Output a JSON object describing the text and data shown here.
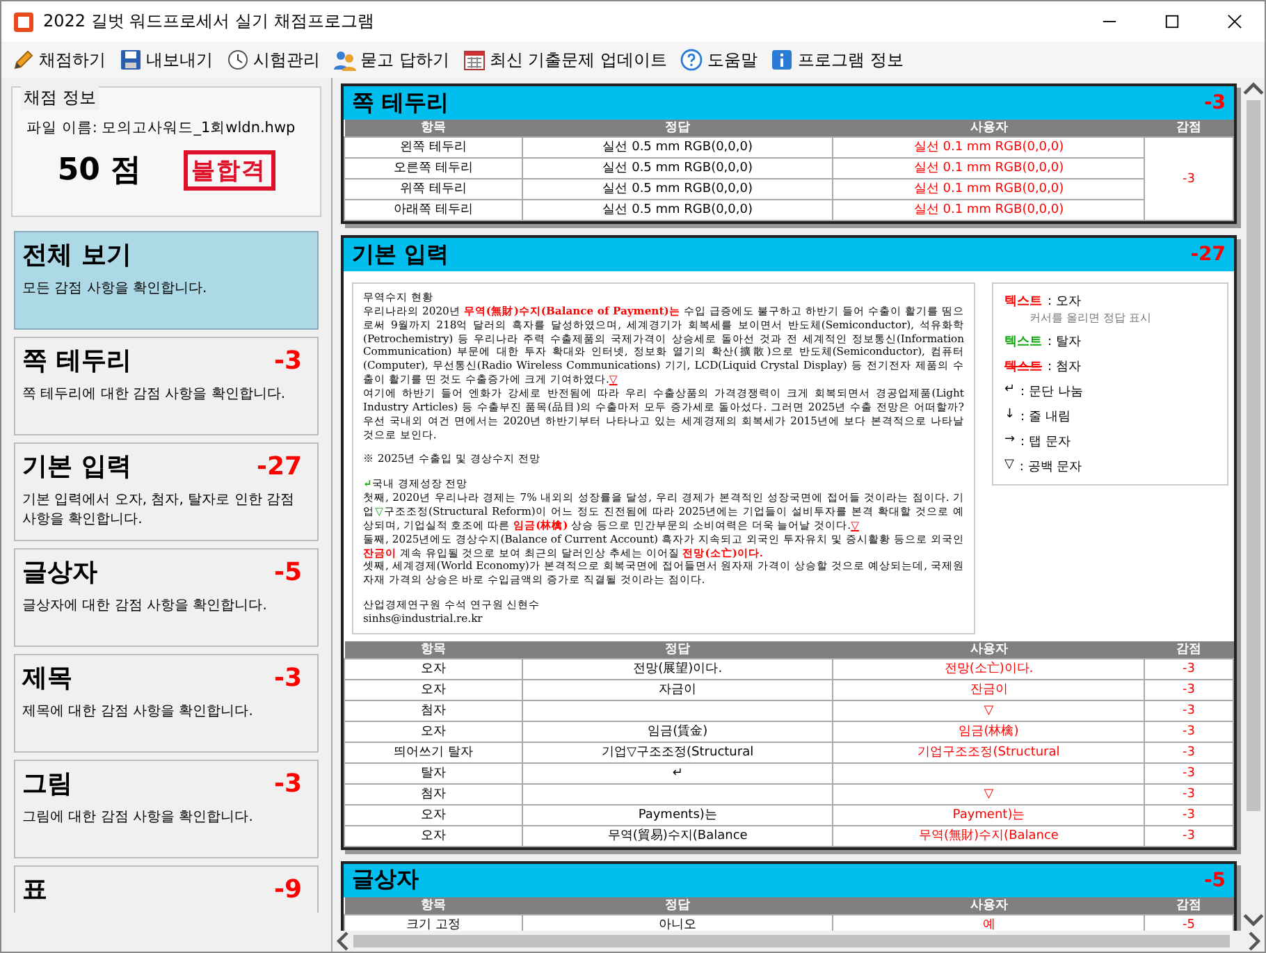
{
  "window": {
    "title": "2022 길벗 워드프로세서 실기 채점프로그램"
  },
  "menu": [
    {
      "label": "채점하기",
      "kind": "pencil"
    },
    {
      "label": "내보내기",
      "kind": "disk"
    },
    {
      "label": "시험관리",
      "kind": "clock"
    },
    {
      "label": "묻고 답하기",
      "kind": "people"
    },
    {
      "label": "최신 기출문제 업데이트",
      "kind": "grid"
    },
    {
      "label": "도움말",
      "kind": "help"
    },
    {
      "label": "프로그램 정보",
      "kind": "info"
    }
  ],
  "score_info": {
    "legend": "채점 정보",
    "file_label": "파일 이름: 모의고사워드_1회wldn.hwp",
    "score": "50 점",
    "result": "불합격"
  },
  "categories": [
    {
      "title": "전체 보기",
      "description": "모든 감점 사항을 확인합니다.",
      "selected": true
    },
    {
      "title": "쪽 테두리",
      "deduction": "-3",
      "description": "쪽 테두리에 대한 감점 사항을 확인합니다.",
      "selected": false
    },
    {
      "title": "기본 입력",
      "deduction": "-27",
      "description": "기본 입력에서 오자, 첨자, 탈자로 인한 감점 사항을 확인합니다.",
      "selected": false
    },
    {
      "title": "글상자",
      "deduction": "-5",
      "description": "글상자에 대한 감점 사항을 확인합니다.",
      "selected": false
    },
    {
      "title": "제목",
      "deduction": "-3",
      "description": "제목에 대한 감점 사항을 확인합니다.",
      "selected": false
    },
    {
      "title": "그림",
      "deduction": "-3",
      "description": "그림에 대한 감점 사항을 확인합니다.",
      "selected": false
    },
    {
      "title": "표",
      "deduction": "-9",
      "selected": false
    }
  ],
  "sections": [
    {
      "title": "쪽 테두리",
      "deduction": "-3",
      "columns": [
        "항목",
        "정답",
        "사용자",
        "감점"
      ],
      "merged_deduction": "-3",
      "rows": [
        {
          "item": "왼쪽 테두리",
          "answer": "실선 0.5 mm RGB(0,0,0)",
          "user": "실선 0.1 mm RGB(0,0,0)"
        },
        {
          "item": "오른쪽 테두리",
          "answer": "실선 0.5 mm RGB(0,0,0)",
          "user": "실선 0.1 mm RGB(0,0,0)"
        },
        {
          "item": "위쪽 테두리",
          "answer": "실선 0.5 mm RGB(0,0,0)",
          "user": "실선 0.1 mm RGB(0,0,0)"
        },
        {
          "item": "아래쪽 테두리",
          "answer": "실선 0.5 mm RGB(0,0,0)",
          "user": "실선 0.1 mm RGB(0,0,0)"
        }
      ]
    },
    {
      "title": "기본 입력",
      "deduction": "-27",
      "document": [
        {
          "runs": [
            {
              "kind": "normal",
              "text": "무역수지 현황"
            }
          ]
        },
        {
          "runs": [
            {
              "kind": "normal",
              "text": "우리나라의 2020년 "
            },
            {
              "kind": "error",
              "text": "무역(無財)수지(Balance of Payment)는"
            },
            {
              "kind": "normal",
              "text": " 수입 급증에도 불구하고 하반기 들어 수출이 활기를 띰으로써 9월까지 218억 달러의 흑자를 달성하였으며, 세계경기가 회복세를 보이면서 반도체(Semiconductor), 석유화학(Petrochemistry) 등 우리나라 주력 수출제품의 국제가격이 상승세로 돌아선 것과 전 세계적인 정보통신(Information Communication) 부문에 대한 투자 확대와 인터넷, 정보화 열기의 확산(擴散)으로 반도체(Semiconductor), 컴퓨터(Computer), 무선통신(Radio Wireless Communications) 기기, LCD(Liquid Crystal Display) 등 전기전자 제품의 수출이 활기를 띤 것도 수출증가에 크게 기여하였다."
            },
            {
              "kind": "extra",
              "text": "▽"
            }
          ]
        },
        {
          "runs": [
            {
              "kind": "normal",
              "text": "여기에 하반기 들어 엔화가 강세로 반전됨에 따라 우리 수출상품의 가격경쟁력이 크게 회복되면서 경공업제품(Light Industry Articles) 등 수출부진 품목(品目)의 수출마저 모두 증가세로 돌아섰다. 그러면 2025년 수출 전망은 어떠할까? 우선 국내외 여건 면에서는 2020년 하반기부터 나타나고 있는 세계경제의 회복세가 2015년에 보다 본격적으로 나타날 것으로 보인다."
            }
          ]
        },
        {
          "space_before": true,
          "runs": [
            {
              "kind": "normal",
              "text": "※ 2025년 수출입 및 경상수지 전망"
            }
          ]
        },
        {
          "space_before": true,
          "runs": [
            {
              "kind": "missing",
              "text": "↵"
            },
            {
              "kind": "normal",
              "text": "국내 경제성장 전망"
            }
          ]
        },
        {
          "runs": [
            {
              "kind": "normal",
              "text": "첫째, 2020년 우리나라 경제는 7% 내외의 성장률을 달성, 우리 경제가 본격적인 성장국면에 접어들 것이라는 점이다. 기업"
            },
            {
              "kind": "missing",
              "text": "▽"
            },
            {
              "kind": "normal",
              "text": "구조조정(Structural Reform)이 어느 정도 진전됨에 따라 2025년에는 기업들이 설비투자를 본격 확대할 것으로 예상되며, 기업실적 호조에 따른 "
            },
            {
              "kind": "error",
              "text": "임금(林檎)"
            },
            {
              "kind": "normal",
              "text": " 상승 등으로 민간부문의 소비여력은 더욱 늘어날 것이다."
            },
            {
              "kind": "extra",
              "text": "▽"
            }
          ]
        },
        {
          "runs": [
            {
              "kind": "normal",
              "text": "둘째, 2025년에도 경상수지(Balance of Current Account) 흑자가 지속되고 외국인 투자유치 및 증시활황 등으로 외국인 "
            },
            {
              "kind": "error",
              "text": "잔금이"
            },
            {
              "kind": "normal",
              "text": " 계속 유입될 것으로 보여 최근의 달러인상 추세는 이어질 "
            },
            {
              "kind": "error",
              "text": "전망(소亡)이다."
            }
          ]
        },
        {
          "runs": [
            {
              "kind": "normal",
              "text": "셋째, 세계경제(World Economy)가 본격적으로 회복국면에 접어들면서 원자재 가격이 상승할 것으로 예상되는데, 국제원자재 가격의 상승은 바로 수입금액의 증가로 직결될 것이라는 점이다."
            }
          ]
        },
        {
          "space_before": true,
          "runs": [
            {
              "kind": "normal",
              "text": "산업경제연구원 수석 연구원 신현수"
            }
          ]
        },
        {
          "runs": [
            {
              "kind": "normal",
              "text": "sinhs@industrial.re.kr"
            }
          ]
        }
      ],
      "legend": [
        {
          "kind": "error",
          "sample": "텍스트",
          "text": ": 오자",
          "note": "커서를 올리면 정답 표시"
        },
        {
          "kind": "missing",
          "sample": "텍스트",
          "text": ": 탈자"
        },
        {
          "kind": "extra",
          "sample": "텍스트",
          "text": ": 첨자"
        },
        {
          "kind": "symbol",
          "sample": "↵",
          "text": ": 문단 나눔"
        },
        {
          "kind": "symbol",
          "sample": "↓",
          "text": ": 줄 내림"
        },
        {
          "kind": "symbol",
          "sample": "→",
          "text": ": 탭 문자"
        },
        {
          "kind": "symbol",
          "sample": "▽",
          "text": ": 공백 문자"
        }
      ],
      "columns": [
        "항목",
        "정답",
        "사용자",
        "감점"
      ],
      "rows": [
        {
          "item": "오자",
          "answer": "전망(展望)이다.",
          "user": "전망(소亡)이다.",
          "deduction": "-3"
        },
        {
          "item": "오자",
          "answer": "자금이",
          "user": "잔금이",
          "deduction": "-3"
        },
        {
          "item": "첨자",
          "user": "▽",
          "deduction": "-3"
        },
        {
          "item": "오자",
          "answer": "임금(賃金)",
          "user": "임금(林檎)",
          "deduction": "-3"
        },
        {
          "item": "띄어쓰기 탈자",
          "answer": "기업▽구조조정(Structural",
          "user": "기업구조조정(Structural",
          "deduction": "-3"
        },
        {
          "item": "탈자",
          "answer": "↵",
          "deduction": "-3"
        },
        {
          "item": "첨자",
          "user": "▽",
          "deduction": "-3"
        },
        {
          "item": "오자",
          "answer": "Payments)는",
          "user": "Payment)는",
          "deduction": "-3"
        },
        {
          "item": "오자",
          "answer": "무역(貿易)수지(Balance",
          "user": "무역(無財)수지(Balance",
          "deduction": "-3"
        }
      ]
    },
    {
      "title": "글상자",
      "deduction": "-5",
      "columns": [
        "항목",
        "정답",
        "사용자",
        "감점"
      ],
      "rows": [
        {
          "item": "크기 고정",
          "answer": "아니오",
          "user": "예",
          "deduction": "-5"
        }
      ]
    }
  ]
}
